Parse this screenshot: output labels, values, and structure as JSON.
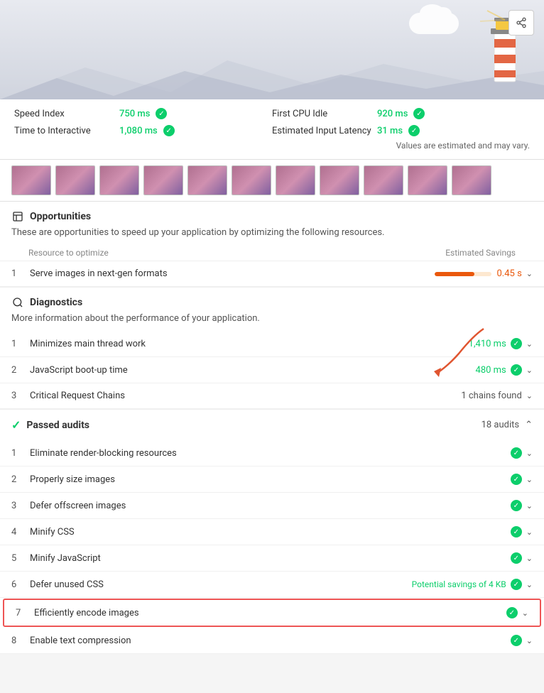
{
  "header": {
    "share_label": "share"
  },
  "metrics": {
    "note": "Values are estimated and may vary.",
    "items": [
      {
        "label": "Speed Index",
        "value": "750 ms",
        "col": 1
      },
      {
        "label": "First CPU Idle",
        "value": "920 ms",
        "col": 2
      },
      {
        "label": "Time to Interactive",
        "value": "1,080 ms",
        "col": 1
      },
      {
        "label": "Estimated Input Latency",
        "value": "31 ms",
        "col": 2
      }
    ]
  },
  "opportunities": {
    "title": "Opportunities",
    "description": "These are opportunities to speed up your application by optimizing the following resources.",
    "col1": "Resource to optimize",
    "col2": "Estimated Savings",
    "items": [
      {
        "num": "1",
        "label": "Serve images in next-gen formats",
        "savings": "0.45 s",
        "bar_pct": 70
      }
    ]
  },
  "diagnostics": {
    "title": "Diagnostics",
    "description": "More information about the performance of your application.",
    "items": [
      {
        "num": "1",
        "label": "Minimizes main thread work",
        "value": "1,410 ms",
        "type": "green_check"
      },
      {
        "num": "2",
        "label": "JavaScript boot-up time",
        "value": "480 ms",
        "type": "green_check"
      },
      {
        "num": "3",
        "label": "Critical Request Chains",
        "value": "1 chains found",
        "type": "normal"
      }
    ]
  },
  "passed_audits": {
    "title": "Passed audits",
    "count": "18 audits",
    "items": [
      {
        "num": "1",
        "label": "Eliminate render-blocking resources",
        "type": "green_check"
      },
      {
        "num": "2",
        "label": "Properly size images",
        "type": "green_check"
      },
      {
        "num": "3",
        "label": "Defer offscreen images",
        "type": "green_check"
      },
      {
        "num": "4",
        "label": "Minify CSS",
        "type": "green_check"
      },
      {
        "num": "5",
        "label": "Minify JavaScript",
        "type": "green_check"
      },
      {
        "num": "6",
        "label": "Defer unused CSS",
        "value": "Potential savings of 4 KB",
        "type": "green_check"
      },
      {
        "num": "7",
        "label": "Efficiently encode images",
        "type": "green_check",
        "highlighted": true
      },
      {
        "num": "8",
        "label": "Enable text compression",
        "type": "green_check"
      }
    ]
  }
}
